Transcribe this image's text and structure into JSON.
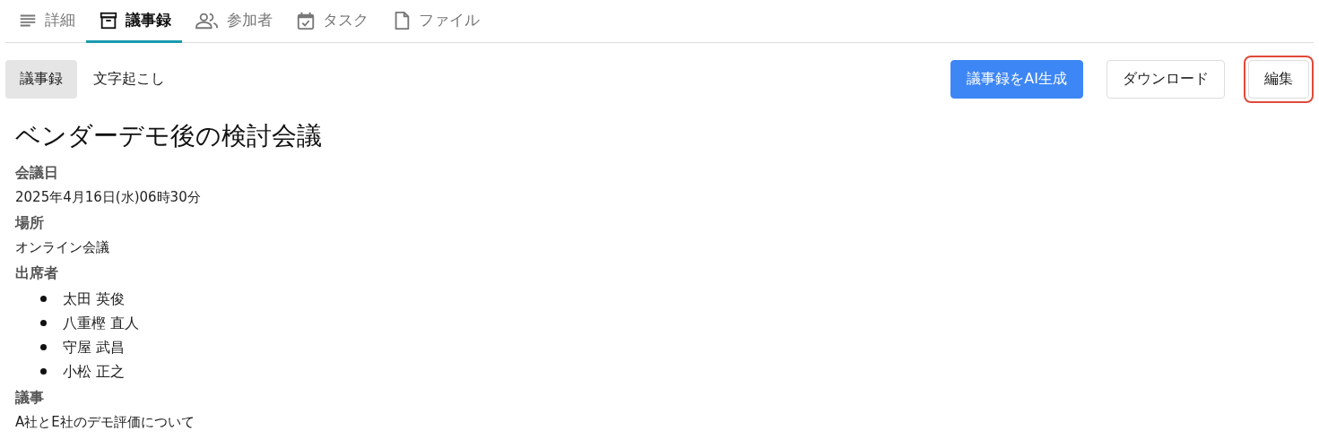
{
  "tabs": [
    {
      "label": "詳細",
      "selected": false
    },
    {
      "label": "議事録",
      "selected": true
    },
    {
      "label": "参加者",
      "selected": false
    },
    {
      "label": "タスク",
      "selected": false
    },
    {
      "label": "ファイル",
      "selected": false
    }
  ],
  "subtabs": [
    {
      "label": "議事録",
      "selected": true
    },
    {
      "label": "文字起こし",
      "selected": false
    }
  ],
  "actions": [
    {
      "label": "議事録をAI生成",
      "kind": "primary",
      "highlighted": false
    },
    {
      "label": "ダウンロード",
      "kind": "default",
      "highlighted": false
    },
    {
      "label": "編集",
      "kind": "default",
      "highlighted": true
    }
  ],
  "document": {
    "title": "ベンダーデモ後の検討会議",
    "sections": [
      {
        "heading": "会議日",
        "kind": "text",
        "text": "2025年4月16日(水)06時30分"
      },
      {
        "heading": "場所",
        "kind": "text",
        "text": "オンライン会議"
      },
      {
        "heading": "出席者",
        "kind": "list",
        "items": [
          "太田 英俊",
          "八重樫 直人",
          "守屋 武昌",
          "小松 正之"
        ]
      },
      {
        "heading": "議事",
        "kind": "text",
        "text": "A社とE社のデモ評価について"
      }
    ]
  }
}
